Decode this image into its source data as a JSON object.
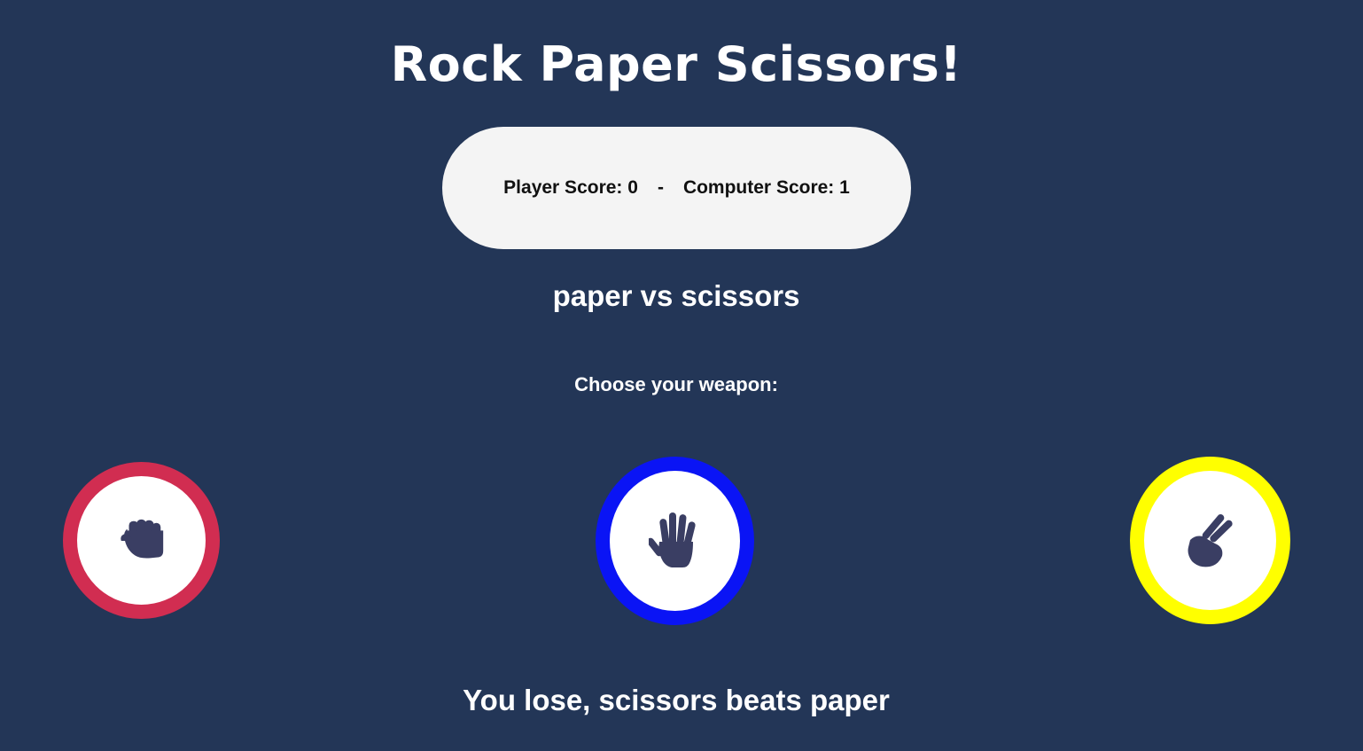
{
  "title": "Rock Paper Scissors!",
  "score": {
    "player_text": "Player Score: 0",
    "separator": "-",
    "computer_text": "Computer Score: 1"
  },
  "matchup": "paper vs scissors",
  "prompt": "Choose your weapon:",
  "weapons": [
    {
      "id": "rock",
      "icon": "fist-icon",
      "ring_color": "#d12d51"
    },
    {
      "id": "paper",
      "icon": "open-hand-icon",
      "ring_color": "#0a14f5"
    },
    {
      "id": "scissors",
      "icon": "peace-hand-icon",
      "ring_color": "#ffff00"
    }
  ],
  "result": "You lose, scissors beats paper",
  "colors": {
    "background": "#233657",
    "icon": "#3a3e63",
    "score_pill": "#f4f4f4"
  }
}
